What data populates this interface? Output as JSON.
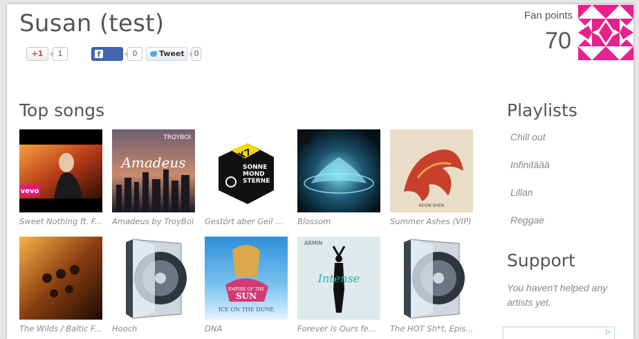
{
  "profile": {
    "name": "Susan (test)",
    "fan_points_label": "Fan points",
    "fan_points_value": "70"
  },
  "social": {
    "gplus_label": "+1",
    "gplus_count": "1",
    "fb_label": "Like",
    "fb_count": "0",
    "tweet_label": "Tweet",
    "tweet_count": "0"
  },
  "top_songs": {
    "title": "Top songs",
    "songs": [
      {
        "title": "Sweet Nothing ft. F..."
      },
      {
        "title": "Amadeus by TroyBoi",
        "cover_text": "Amadeus",
        "cover_tag": "TROYBOI"
      },
      {
        "title": "Gestört aber Geil ...",
        "cover_text_1": "X7",
        "cover_text_2": "SONNE MOND STERNE"
      },
      {
        "title": "Blossom"
      },
      {
        "title": "Summer Ashes (VIP)",
        "cover_tag": "KEVIN SHEN"
      },
      {
        "title": "The Wilds / Baltic F..."
      },
      {
        "title": "Hooch"
      },
      {
        "title": "DNA",
        "cover_text_1": "EMPIRE OF THE",
        "cover_text_2": "SUN",
        "cover_text_3": "ICE ON THE DUNE"
      },
      {
        "title": "Forever Is Ours fe...",
        "cover_tag": "ARMIN",
        "cover_text": "Intense"
      },
      {
        "title": "The HOT Sh*t, Epis..."
      }
    ]
  },
  "playlists": {
    "title": "Playlists",
    "items": [
      "Chill out",
      "Infinitäää",
      "Lillan",
      "Reggae"
    ]
  },
  "support": {
    "title": "Support",
    "text": "You haven't helped any artists yet."
  },
  "colors": {
    "avatar_pink": "#e8218c",
    "heading_gray": "#555555",
    "muted_italic": "#888888",
    "facebook_blue": "#4267b2"
  }
}
